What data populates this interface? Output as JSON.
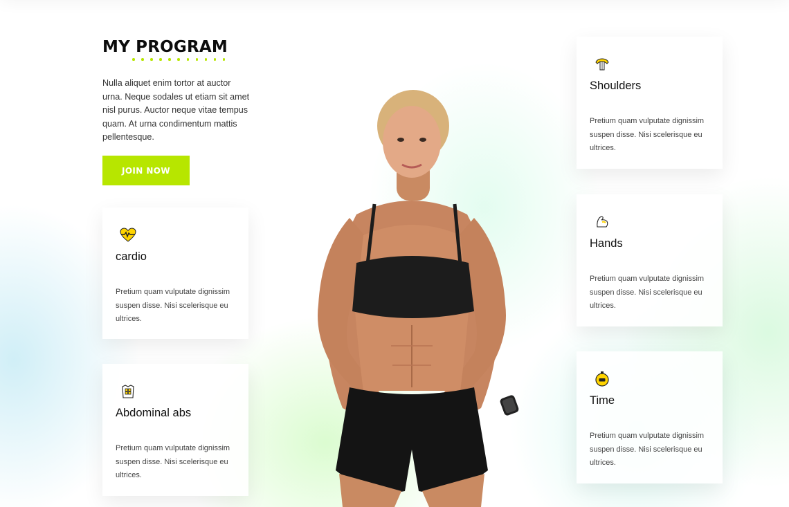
{
  "program": {
    "title": "MY PROGRAM",
    "intro": "Nulla aliquet enim tortor at auctor urna. Neque sodales ut etiam sit amet nisl purus. Auctor neque vitae tempus quam. At urna condimentum mattis pellentesque.",
    "join_label": "JOIN NOW"
  },
  "cards": {
    "cardio": {
      "title": "cardio",
      "text": "Pretium quam vulputate dignissim suspen disse. Nisi scelerisque eu ultrices.",
      "icon": "heartbeat-icon"
    },
    "abs": {
      "title": "Abdominal abs",
      "text": "Pretium quam vulputate dignissim suspen disse. Nisi scelerisque eu ultrices.",
      "icon": "abs-icon"
    },
    "shoulders": {
      "title": "Shoulders",
      "text": "Pretium quam vulputate dignissim suspen disse. Nisi scelerisque eu ultrices.",
      "icon": "shoulders-icon"
    },
    "hands": {
      "title": "Hands",
      "text": "Pretium quam vulputate dignissim suspen disse. Nisi scelerisque eu ultrices.",
      "icon": "bicep-icon"
    },
    "time": {
      "title": "Time",
      "text": "Pretium quam vulputate dignissim suspen disse. Nisi scelerisque eu ultrices.",
      "icon": "stopwatch-icon"
    }
  },
  "colors": {
    "accent": "#b7e600",
    "text_dark": "#0c0c0c",
    "icon_yellow": "#ffd400"
  }
}
